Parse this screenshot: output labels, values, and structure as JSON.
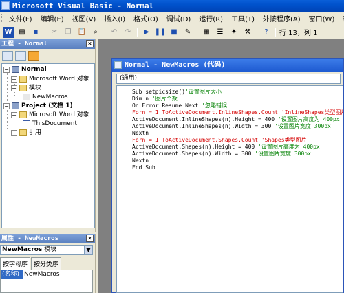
{
  "window": {
    "title": "Microsoft Visual Basic - Normal"
  },
  "menu": [
    "文件(F)",
    "编辑(E)",
    "视图(V)",
    "插入(I)",
    "格式(O)",
    "调试(D)",
    "运行(R)",
    "工具(T)",
    "外接程序(A)",
    "窗口(W)",
    "帮助"
  ],
  "toolbar": {
    "position": "行 13，列 1"
  },
  "project_panel": {
    "title": "工程 - Normal",
    "tree": [
      {
        "label": "Normal",
        "bold": true
      },
      {
        "label": "Microsoft Word 对象"
      },
      {
        "label": "模块"
      },
      {
        "label": "NewMacros"
      },
      {
        "label": "Project (文档 1)",
        "bold": true
      },
      {
        "label": "Microsoft Word 对象"
      },
      {
        "label": "ThisDocument"
      },
      {
        "label": "引用"
      }
    ]
  },
  "properties_panel": {
    "title": "属性 - NewMacros",
    "object_name": "NewMacros",
    "object_type": "模块",
    "tabs": [
      "按字母序",
      "按分类序"
    ],
    "rows": [
      {
        "key": "(名称)",
        "value": "NewMacros"
      }
    ]
  },
  "code_window": {
    "title": "Normal - NewMacros (代码)",
    "object_combo": "(通用)",
    "lines": [
      [
        {
          "t": "Sub setpicsize()",
          "s": "k"
        },
        {
          "t": "'设置图片大小",
          "s": "c"
        }
      ],
      [
        {
          "t": "Dim n ",
          "s": "k"
        },
        {
          "t": "'图片个数",
          "s": "c"
        }
      ],
      [
        {
          "t": "On Error Resume Next ",
          "s": "k"
        },
        {
          "t": "'忽略错误",
          "s": "c"
        }
      ],
      [
        {
          "t": "Forn = 1 ToActiveDocument.InlineShapes.Count ",
          "s": "r"
        },
        {
          "t": "'InlineShapes类型图片",
          "s": "rk"
        }
      ],
      [
        {
          "t": "ActiveDocument.InlineShapes(n).Height = 400 ",
          "s": "k"
        },
        {
          "t": "'设置图片高度为 400px",
          "s": "c"
        }
      ],
      [
        {
          "t": "ActiveDocument.InlineShapes(n).Width = 300 ",
          "s": "k"
        },
        {
          "t": "'设置图片宽度 300px",
          "s": "c"
        }
      ],
      [
        {
          "t": "Nextn",
          "s": "k"
        }
      ],
      [
        {
          "t": "Forn = 1 ToActiveDocument.Shapes.Count ",
          "s": "r"
        },
        {
          "t": "'Shapes类型图片",
          "s": "rk"
        }
      ],
      [
        {
          "t": "ActiveDocument.Shapes(n).Height = 400 ",
          "s": "k"
        },
        {
          "t": "'设置图片高度为 400px",
          "s": "c"
        }
      ],
      [
        {
          "t": "ActiveDocument.Shapes(n).Width = 300 ",
          "s": "k"
        },
        {
          "t": "'设置图片宽度 300px",
          "s": "c"
        }
      ],
      [
        {
          "t": "Nextn",
          "s": "k"
        }
      ],
      [
        {
          "t": "End Sub",
          "s": "k"
        }
      ]
    ]
  }
}
